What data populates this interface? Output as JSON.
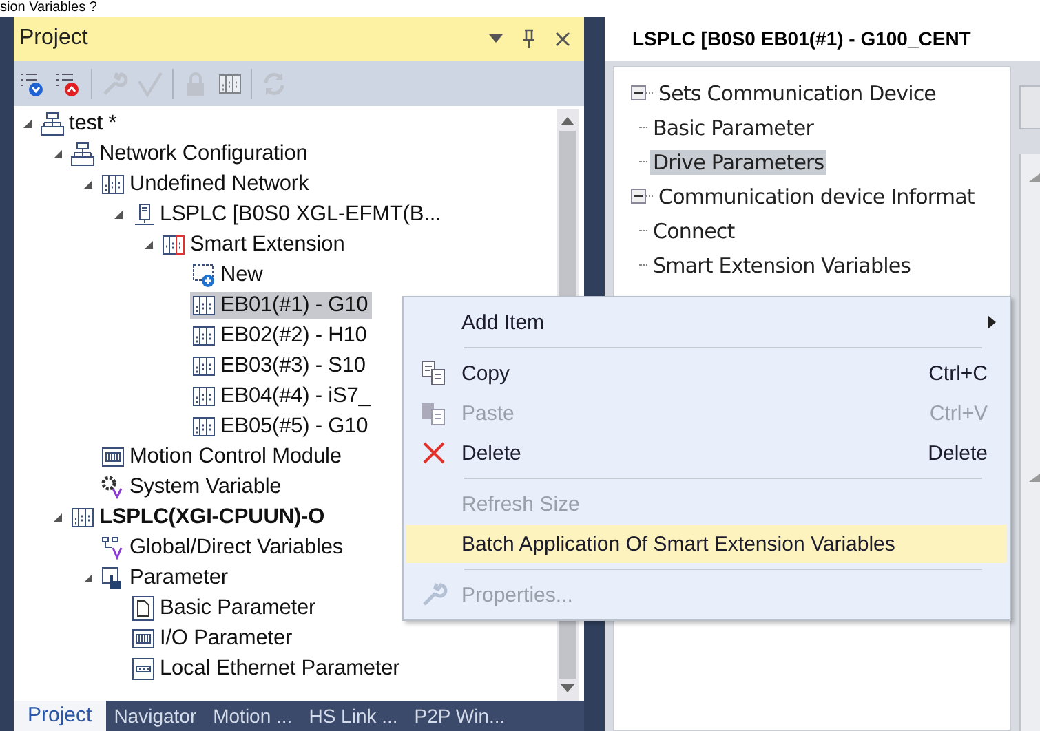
{
  "top_text": "sion Variables ?",
  "project_panel": {
    "title": "Project",
    "toolbar": [
      {
        "disabled": false
      },
      {
        "disabled": false
      },
      {
        "disabled": true
      },
      {
        "disabled": true
      },
      {
        "disabled": true
      },
      {
        "disabled": true
      },
      {
        "disabled": true
      }
    ],
    "tree": [
      {
        "label": "test *",
        "kind": "network",
        "expanded": true,
        "selected": false,
        "bold": false,
        "children": [
          {
            "label": "Network Configuration",
            "kind": "network",
            "expanded": true,
            "selected": false,
            "bold": false,
            "children": [
              {
                "label": "Undefined Network",
                "kind": "module",
                "expanded": true,
                "selected": false,
                "bold": false,
                "children": [
                  {
                    "label": "LSPLC [B0S0 XGL-EFMT(B...",
                    "kind": "plc",
                    "expanded": true,
                    "selected": false,
                    "bold": false,
                    "children": [
                      {
                        "label": "Smart Extension",
                        "kind": "smart",
                        "expanded": true,
                        "selected": false,
                        "bold": false,
                        "children": [
                          {
                            "label": "New",
                            "kind": "new",
                            "selected": false,
                            "bold": false
                          },
                          {
                            "label": "EB01(#1) - G10",
                            "kind": "module",
                            "selected": true,
                            "bold": false
                          },
                          {
                            "label": "EB02(#2) - H10",
                            "kind": "module",
                            "selected": false,
                            "bold": false
                          },
                          {
                            "label": "EB03(#3) - S10",
                            "kind": "module",
                            "selected": false,
                            "bold": false
                          },
                          {
                            "label": "EB04(#4) - iS7_",
                            "kind": "module",
                            "selected": false,
                            "bold": false
                          },
                          {
                            "label": "EB05(#5) - G10",
                            "kind": "module",
                            "selected": false,
                            "bold": false
                          }
                        ]
                      }
                    ]
                  }
                ]
              },
              {
                "label": "Motion Control Module",
                "kind": "motion",
                "selected": false,
                "bold": false
              },
              {
                "label": "System Variable",
                "kind": "sysvar",
                "selected": false,
                "bold": false
              }
            ]
          },
          {
            "label": "LSPLC(XGI-CPUUN)-O",
            "kind": "module",
            "expanded": true,
            "selected": false,
            "bold": true,
            "children": [
              {
                "label": "Global/Direct Variables",
                "kind": "globalvar",
                "selected": false,
                "bold": false
              },
              {
                "label": "Parameter",
                "kind": "param",
                "expanded": true,
                "selected": false,
                "bold": false,
                "children": [
                  {
                    "label": "Basic Parameter",
                    "kind": "doc",
                    "selected": false,
                    "bold": false
                  },
                  {
                    "label": "I/O Parameter",
                    "kind": "motion",
                    "selected": false,
                    "bold": false
                  },
                  {
                    "label": "Local Ethernet Parameter",
                    "kind": "ethernet",
                    "selected": false,
                    "bold": false
                  }
                ]
              }
            ]
          }
        ]
      }
    ]
  },
  "bottom_tabs": [
    {
      "label": "Project",
      "selected": true
    },
    {
      "label": "Navigator",
      "selected": false
    },
    {
      "label": "Motion ...",
      "selected": false
    },
    {
      "label": "HS Link ...",
      "selected": false
    },
    {
      "label": "P2P Win...",
      "selected": false
    }
  ],
  "editor": {
    "title": "LSPLC [B0S0 EB01(#1) - G100_CENT",
    "tree": [
      {
        "label": "Sets Communication Device",
        "expanded": true,
        "selected": false,
        "children": [
          {
            "label": "Basic Parameter",
            "selected": false
          },
          {
            "label": "Drive Parameters",
            "selected": true
          }
        ]
      },
      {
        "label": "Communication device Informat",
        "expanded": true,
        "selected": false,
        "children": [
          {
            "label": "Connect",
            "selected": false
          },
          {
            "label": "Smart Extension Variables",
            "selected": false
          }
        ]
      }
    ]
  },
  "context_menu": [
    {
      "kind": "item",
      "label": "Add Item",
      "submenu": true,
      "disabled": false,
      "highlighted": false
    },
    {
      "kind": "separator"
    },
    {
      "kind": "item",
      "label": "Copy",
      "shortcut": "Ctrl+C",
      "disabled": false,
      "highlighted": false
    },
    {
      "kind": "item",
      "label": "Paste",
      "shortcut": "Ctrl+V",
      "disabled": true,
      "highlighted": false
    },
    {
      "kind": "item",
      "label": "Delete",
      "shortcut": "Delete",
      "disabled": false,
      "highlighted": false
    },
    {
      "kind": "separator"
    },
    {
      "kind": "item",
      "label": "Refresh Size",
      "disabled": true,
      "highlighted": false
    },
    {
      "kind": "item",
      "label": "Batch Application Of Smart Extension Variables",
      "disabled": false,
      "highlighted": true
    },
    {
      "kind": "separator"
    },
    {
      "kind": "item",
      "label": "Properties...",
      "disabled": true,
      "highlighted": false
    }
  ]
}
